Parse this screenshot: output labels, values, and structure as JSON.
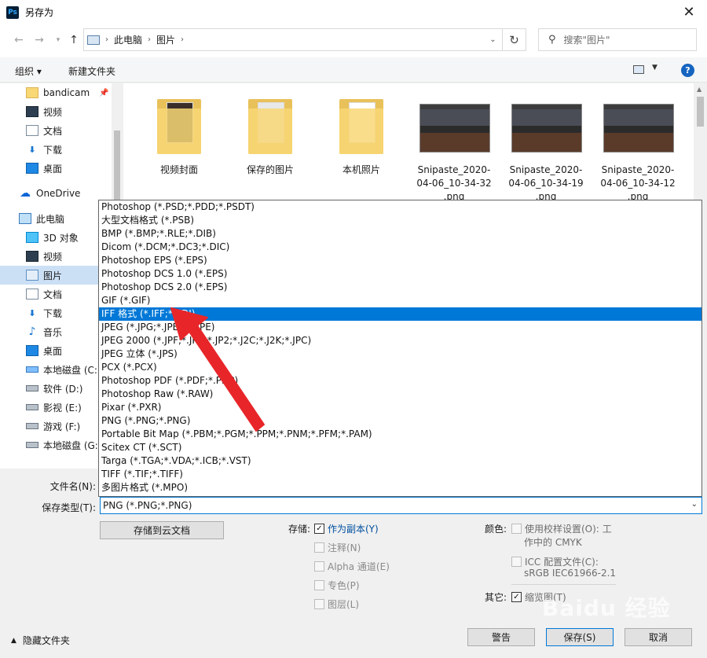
{
  "window": {
    "title": "另存为",
    "app_icon": "Ps"
  },
  "address": {
    "crumbs": [
      "此电脑",
      "图片"
    ],
    "search_placeholder": "搜索\"图片\""
  },
  "toolbar": {
    "organize": "组织",
    "new_folder": "新建文件夹",
    "help": "?"
  },
  "nav": {
    "items": [
      {
        "label": "bandicam",
        "icon": "folder-icon",
        "pinned": true
      },
      {
        "label": "视频",
        "icon": "video-icon"
      },
      {
        "label": "文档",
        "icon": "document-icon"
      },
      {
        "label": "下载",
        "icon": "download-icon"
      },
      {
        "label": "桌面",
        "icon": "desktop-icon"
      },
      {
        "label": "OneDrive",
        "icon": "cloud-icon"
      },
      {
        "label": "此电脑",
        "icon": "pc-icon"
      },
      {
        "label": "3D 对象",
        "icon": "3d-objects-icon"
      },
      {
        "label": "视频",
        "icon": "video-icon"
      },
      {
        "label": "图片",
        "icon": "pictures-icon",
        "selected": true
      },
      {
        "label": "文档",
        "icon": "document-icon"
      },
      {
        "label": "下载",
        "icon": "download-icon"
      },
      {
        "label": "音乐",
        "icon": "music-icon"
      },
      {
        "label": "桌面",
        "icon": "desktop-icon"
      },
      {
        "label": "本地磁盘 (C:)",
        "icon": "system-drive-icon"
      },
      {
        "label": "软件 (D:)",
        "icon": "drive-icon"
      },
      {
        "label": "影视 (E:)",
        "icon": "drive-icon"
      },
      {
        "label": "游戏 (F:)",
        "icon": "drive-icon"
      },
      {
        "label": "本地磁盘 (G:)",
        "icon": "drive-icon"
      }
    ]
  },
  "files": [
    {
      "name": "视频封面",
      "kind": "folder"
    },
    {
      "name": "保存的图片",
      "kind": "folder"
    },
    {
      "name": "本机照片",
      "kind": "folder"
    },
    {
      "name": "Snipaste_2020-04-06_10-34-32.png",
      "line1": "Snipaste_2020-",
      "line2": "04-06_10-34-32",
      "line3": ".png",
      "kind": "image"
    },
    {
      "name": "Snipaste_2020-04-06_10-34-19.png",
      "line1": "Snipaste_2020-",
      "line2": "04-06_10-34-19",
      "line3": ".png",
      "kind": "image"
    },
    {
      "name": "Snipaste_2020-04-06_10-34-12.png",
      "line1": "Snipaste_2020-",
      "line2": "04-06_10-34-12",
      "line3": ".png",
      "kind": "image"
    }
  ],
  "type_options": [
    "Photoshop (*.PSD;*.PDD;*.PSDT)",
    "大型文档格式 (*.PSB)",
    "BMP (*.BMP;*.RLE;*.DIB)",
    "Dicom (*.DCM;*.DC3;*.DIC)",
    "Photoshop EPS (*.EPS)",
    "Photoshop DCS 1.0 (*.EPS)",
    "Photoshop DCS 2.0 (*.EPS)",
    "GIF (*.GIF)",
    "IFF 格式 (*.IFF;*.TDI)",
    "JPEG (*.JPG;*.JPEG;*.JPE)",
    "JPEG 2000 (*.JPF;*.JPX;*.JP2;*.J2C;*.J2K;*.JPC)",
    "JPEG 立体 (*.JPS)",
    "PCX (*.PCX)",
    "Photoshop PDF (*.PDF;*.PDP)",
    "Photoshop Raw (*.RAW)",
    "Pixar (*.PXR)",
    "PNG (*.PNG;*.PNG)",
    "Portable Bit Map (*.PBM;*.PGM;*.PPM;*.PNM;*.PFM;*.PAM)",
    "Scitex CT (*.SCT)",
    "Targa (*.TGA;*.VDA;*.ICB;*.VST)",
    "TIFF (*.TIF;*.TIFF)",
    "多图片格式 (*.MPO)"
  ],
  "selected_option_index": 8,
  "form": {
    "filename_label": "文件名(N):",
    "filetype_label": "保存类型(T):",
    "filetype_value": "PNG (*.PNG;*.PNG)",
    "cloud_button": "存储到云文档"
  },
  "options": {
    "save_label": "存储:",
    "as_copy": "作为副本(Y)",
    "notes": "注释(N)",
    "alpha": "Alpha 通道(E)",
    "spot": "专色(P)",
    "layers": "图层(L)",
    "color_label": "颜色:",
    "proof": "使用校样设置(O):",
    "proof_suffix": "工",
    "proof_line2": "作中的 CMYK",
    "icc": "ICC 配置文件(C):",
    "icc_value": "sRGB IEC61966-2.1",
    "other_label": "其它:",
    "thumbnail": "缩览图(T)"
  },
  "footer": {
    "hide_folders": "隐藏文件夹",
    "warning": "警告",
    "save": "保存(S)",
    "cancel": "取消"
  },
  "watermark": "Baidu 经验",
  "colors": {
    "selection": "#0078d7",
    "annotation_arrow": "#e8262a"
  }
}
